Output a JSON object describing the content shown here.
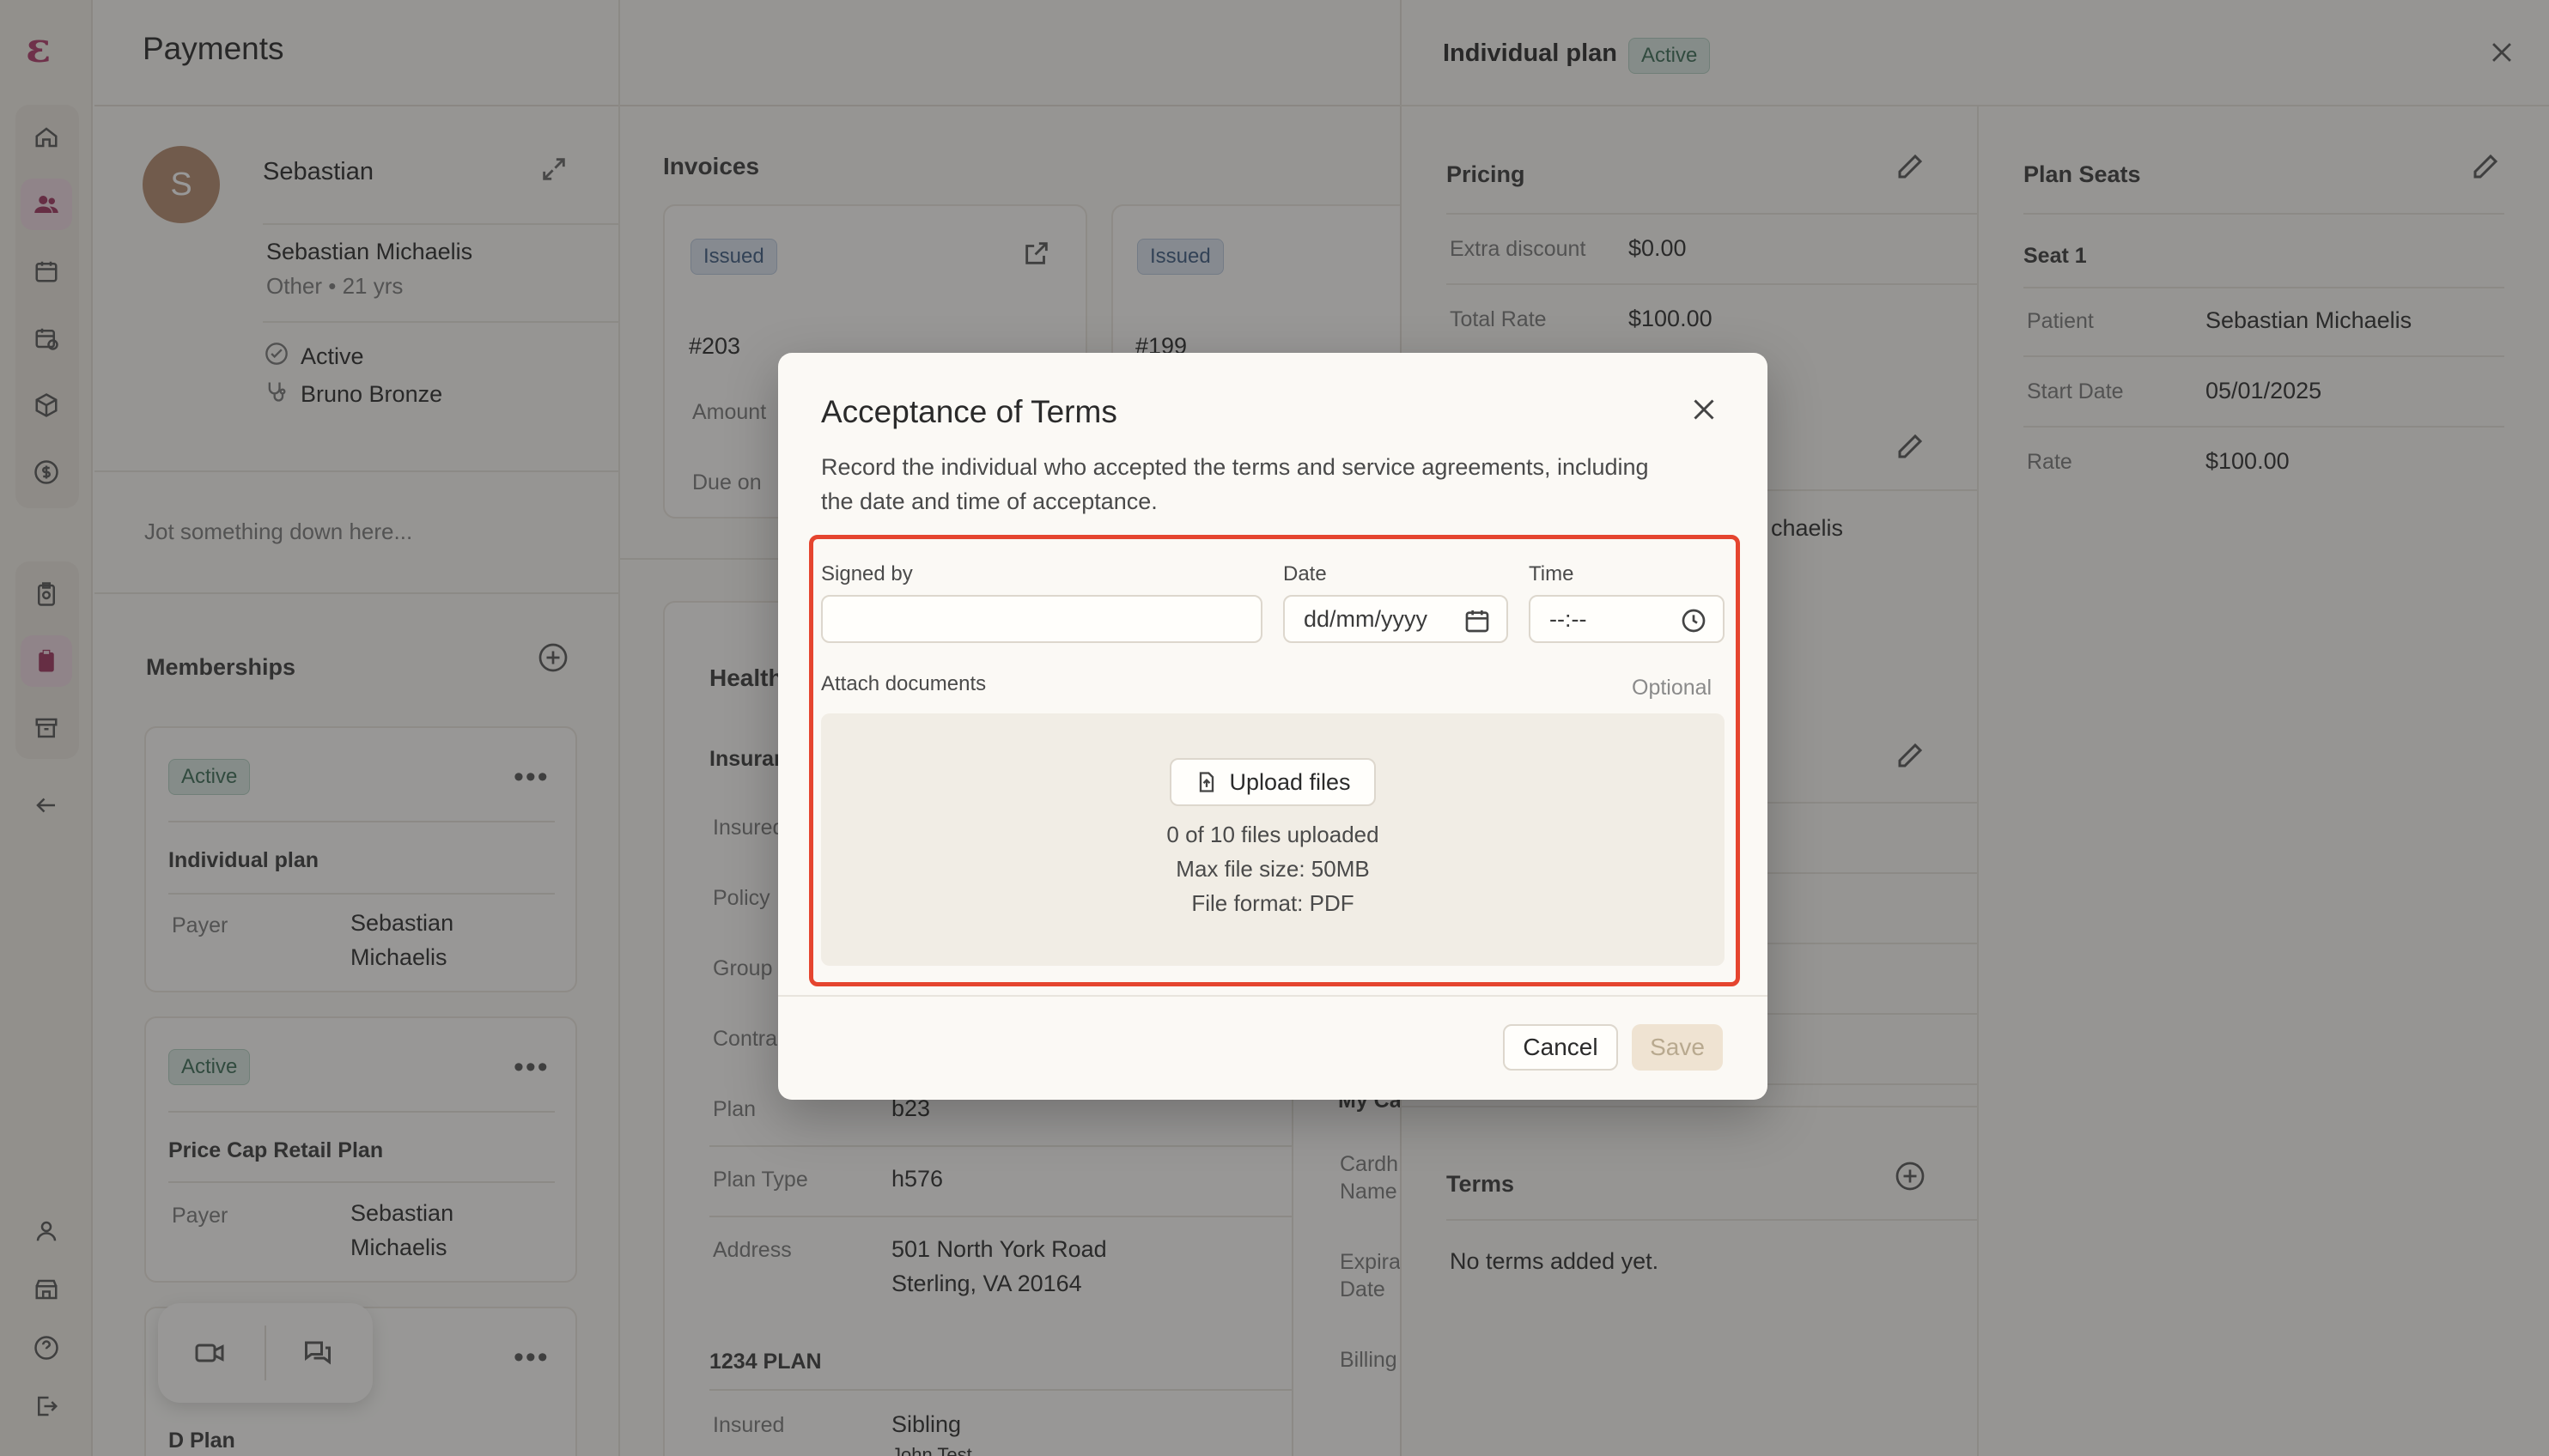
{
  "app": {
    "page_title": "Payments",
    "logo_letter": "ε"
  },
  "nav": {
    "icons": [
      "home-icon",
      "users-icon",
      "calendar-icon",
      "calendar-check-icon",
      "box-icon",
      "dollar-icon",
      "clipboard-icon",
      "clipboard-user-icon",
      "archive-icon",
      "arrow-left-icon"
    ],
    "bottom_icons": [
      "user-icon",
      "store-icon",
      "help-icon",
      "logout-icon"
    ]
  },
  "patient": {
    "avatar_letter": "S",
    "short_name": "Sebastian",
    "full_name": "Sebastian Michaelis",
    "meta": "Other • 21 yrs",
    "status": "Active",
    "provider": "Bruno Bronze",
    "notes_placeholder": "Jot something down here..."
  },
  "memberships": {
    "title": "Memberships",
    "items": [
      {
        "badge": "Active",
        "name": "Individual plan",
        "payer_label": "Payer",
        "payer_line1": "Sebastian",
        "payer_line2": "Michaelis"
      },
      {
        "badge": "Active",
        "name": "Price Cap Retail Plan",
        "payer_label": "Payer",
        "payer_line1": "Sebastian",
        "payer_line2": "Michaelis"
      },
      {
        "name": "D Plan"
      }
    ]
  },
  "invoices": {
    "title": "Invoices",
    "cards": [
      {
        "badge": "Issued",
        "number": "#203",
        "amount_label": "Amount",
        "due_label": "Due on"
      },
      {
        "badge": "Issued",
        "number": "#199"
      }
    ]
  },
  "health": {
    "title": "Health",
    "sub": "Insuran",
    "labels": [
      "Insured",
      "Policy",
      "Group",
      "Contra"
    ],
    "rows": [
      {
        "label": "Plan",
        "value": "b23"
      },
      {
        "label": "Plan Type",
        "value": "h576"
      },
      {
        "label": "Address",
        "value": "501 North York Road",
        "value2": "Sterling, VA 20164"
      }
    ],
    "plan2": "1234 PLAN",
    "insured_label": "Insured",
    "insured_value": "Sibling",
    "insured_value2": "John Test"
  },
  "payment_col": {
    "labels": [
      "My Ca",
      "Cardh",
      "Name",
      "Expira",
      "Date",
      "Billing"
    ]
  },
  "plan_panel": {
    "title": "Individual plan",
    "badge": "Active",
    "pricing": {
      "title": "Pricing",
      "rows": [
        {
          "label": "Extra discount",
          "value": "$0.00"
        },
        {
          "label": "Total Rate",
          "value": "$100.00"
        }
      ]
    },
    "partial_name": "chaelis",
    "seats": {
      "title": "Plan Seats",
      "seat": "Seat 1",
      "rows": [
        {
          "label": "Patient",
          "value": "Sebastian Michaelis"
        },
        {
          "label": "Start Date",
          "value": "05/01/2025"
        },
        {
          "label": "Rate",
          "value": "$100.00"
        }
      ]
    },
    "terms": {
      "title": "Terms",
      "empty": "No terms added yet."
    }
  },
  "modal": {
    "title": "Acceptance of Terms",
    "description_line1": "Record the individual who accepted the terms and service agreements, including",
    "description_line2": "the date and time of acceptance.",
    "signed_by_label": "Signed by",
    "signed_by_value": "",
    "date_label": "Date",
    "date_placeholder": "dd/mm/yyyy",
    "time_label": "Time",
    "time_placeholder": "--:--",
    "attach_label": "Attach documents",
    "optional": "Optional",
    "upload_button": "Upload files",
    "files_count": "0 of 10 files uploaded",
    "max_size": "Max file size: 50MB",
    "format": "File format: PDF",
    "cancel": "Cancel",
    "save": "Save",
    "highlight_color": "#e5452f"
  }
}
